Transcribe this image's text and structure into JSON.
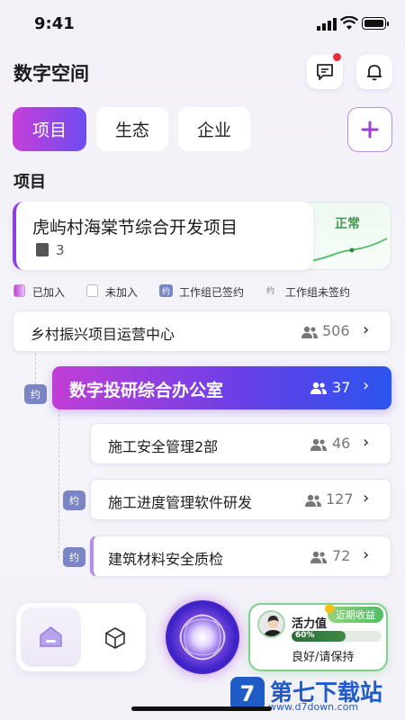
{
  "status_bar": {
    "time": "9:41"
  },
  "header": {
    "title": "数字空间",
    "message_icon": "message-icon",
    "bell_icon": "bell-icon"
  },
  "tabs": [
    {
      "label": "项目",
      "active": true
    },
    {
      "label": "生态",
      "active": false
    },
    {
      "label": "企业",
      "active": false
    }
  ],
  "section_title": "项目",
  "project_card": {
    "name": "虎屿村海棠节综合开发项目",
    "count": "3",
    "status": "正常"
  },
  "legend": [
    {
      "label": "已加入"
    },
    {
      "label": "未加入"
    },
    {
      "tag": "约",
      "label": "工作组已签约"
    },
    {
      "tag": "约",
      "label": "工作组未签约"
    }
  ],
  "tree": [
    {
      "label": "乡村振兴项目运营中心",
      "count": "506"
    },
    {
      "label": "数字投研综合办公室",
      "count": "37",
      "tag": "约",
      "active": true
    },
    {
      "label": "施工安全管理2部",
      "count": "46"
    },
    {
      "label": "施工进度管理软件研发",
      "count": "127",
      "tag": "约"
    },
    {
      "label": "建筑材料安全质检",
      "count": "72",
      "tag": "约"
    }
  ],
  "vitality": {
    "title": "活力值",
    "tag": "近期收益",
    "percent": 60,
    "percent_label": "60%",
    "status": "良好/请保持"
  },
  "watermark": {
    "logo": "7",
    "text": "第七下载站",
    "url": "www.d7down.com"
  },
  "colors": {
    "accent_purple": "#c23ed6",
    "accent_blue": "#2b54ee",
    "green": "#4fbd66"
  }
}
